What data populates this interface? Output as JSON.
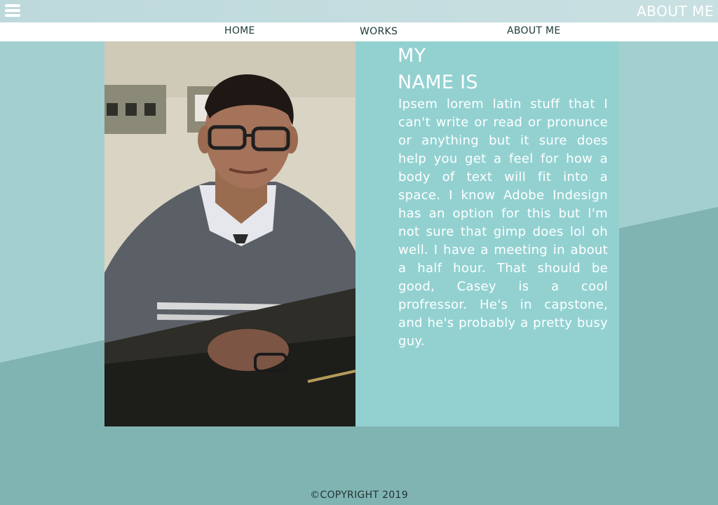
{
  "topbar": {
    "title": "ABOUT ME",
    "menu_icon": "hamburger-menu-icon"
  },
  "nav": {
    "items": [
      {
        "label": "HOME"
      },
      {
        "label": "WORKS"
      },
      {
        "label": "ABOUT ME"
      }
    ]
  },
  "profile": {
    "heading_line1": "MY",
    "heading_line2": "NAME IS",
    "bio": "Ipsem lorem latin stuff that I can't write or read or pronunce or anything but it sure does help you get a feel for how a body of text will fit into a space.  I know Adobe Indesign has an option for this but I'm not sure that gimp does lol oh well.  I have a meeting in about a half hour.  That should be good, Casey is a cool profressor.  He's in capstone, and he's probably a pretty busy guy."
  },
  "footer": {
    "copyright": "©COPYRIGHT 2019"
  },
  "colors": {
    "background_light": "#a4cfcf",
    "background_dark": "#80b4b2",
    "panel": "#93d1d1",
    "text_light": "#ffffff"
  }
}
